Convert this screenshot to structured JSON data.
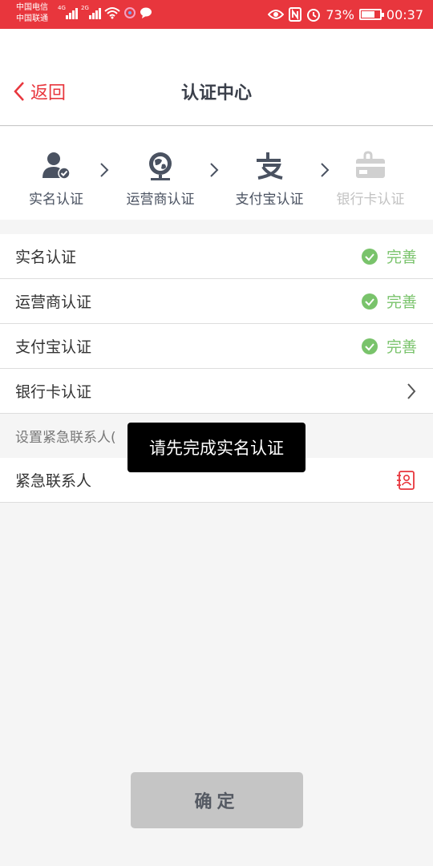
{
  "status_bar": {
    "carrier1": "中国电信",
    "carrier2": "中国联通",
    "sim1_tag": "4G",
    "sim2_tag": "2G",
    "battery": "73%",
    "time": "00:37",
    "bg_color": "#e8363d"
  },
  "header": {
    "back_label": "返回",
    "title": "认证中心"
  },
  "steps": [
    {
      "label": "实名认证",
      "icon": "user-check-icon",
      "enabled": true
    },
    {
      "label": "运营商认证",
      "icon": "globe-carrier-icon",
      "enabled": true
    },
    {
      "label": "支付宝认证",
      "icon": "alipay-icon",
      "enabled": true
    },
    {
      "label": "银行卡认证",
      "icon": "bank-card-icon",
      "enabled": false
    }
  ],
  "verifications": [
    {
      "label": "实名认证",
      "status": "完善"
    },
    {
      "label": "运营商认证",
      "status": "完善"
    },
    {
      "label": "支付宝认证",
      "status": "完善"
    },
    {
      "label": "银行卡认证",
      "status": ""
    }
  ],
  "section_title": "设置紧急联系人(",
  "emergency_contact_label": "紧急联系人",
  "toast": "请先完成实名认证",
  "confirm_label": "确定",
  "colors": {
    "accent": "#e8363d",
    "success": "#79c36b",
    "disabled": "#c2c2c2"
  }
}
